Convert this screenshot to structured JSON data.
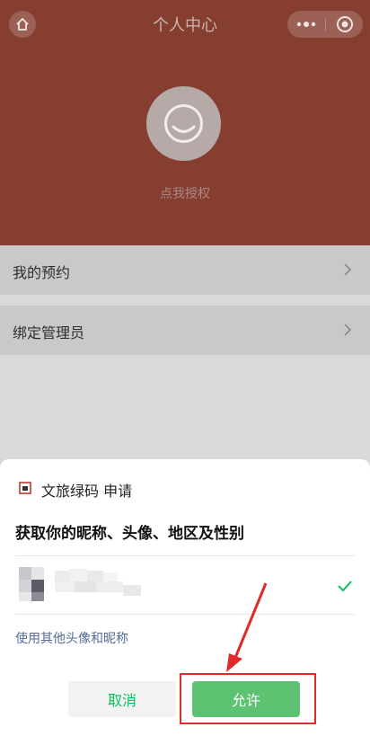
{
  "header": {
    "title": "个人中心",
    "authorize_text": "点我授权",
    "background": "#863e31"
  },
  "menu": {
    "items": [
      {
        "label": "我的预约"
      },
      {
        "label": "绑定管理员"
      }
    ]
  },
  "auth_sheet": {
    "app_name": "文旅绿码 申请",
    "title": "获取你的昵称、头像、地区及性别",
    "use_other_link": "使用其他头像和昵称",
    "cancel_label": "取消",
    "allow_label": "允许",
    "accent": "#07c160"
  },
  "annotation": {
    "highlight_color": "#e02a2a"
  }
}
